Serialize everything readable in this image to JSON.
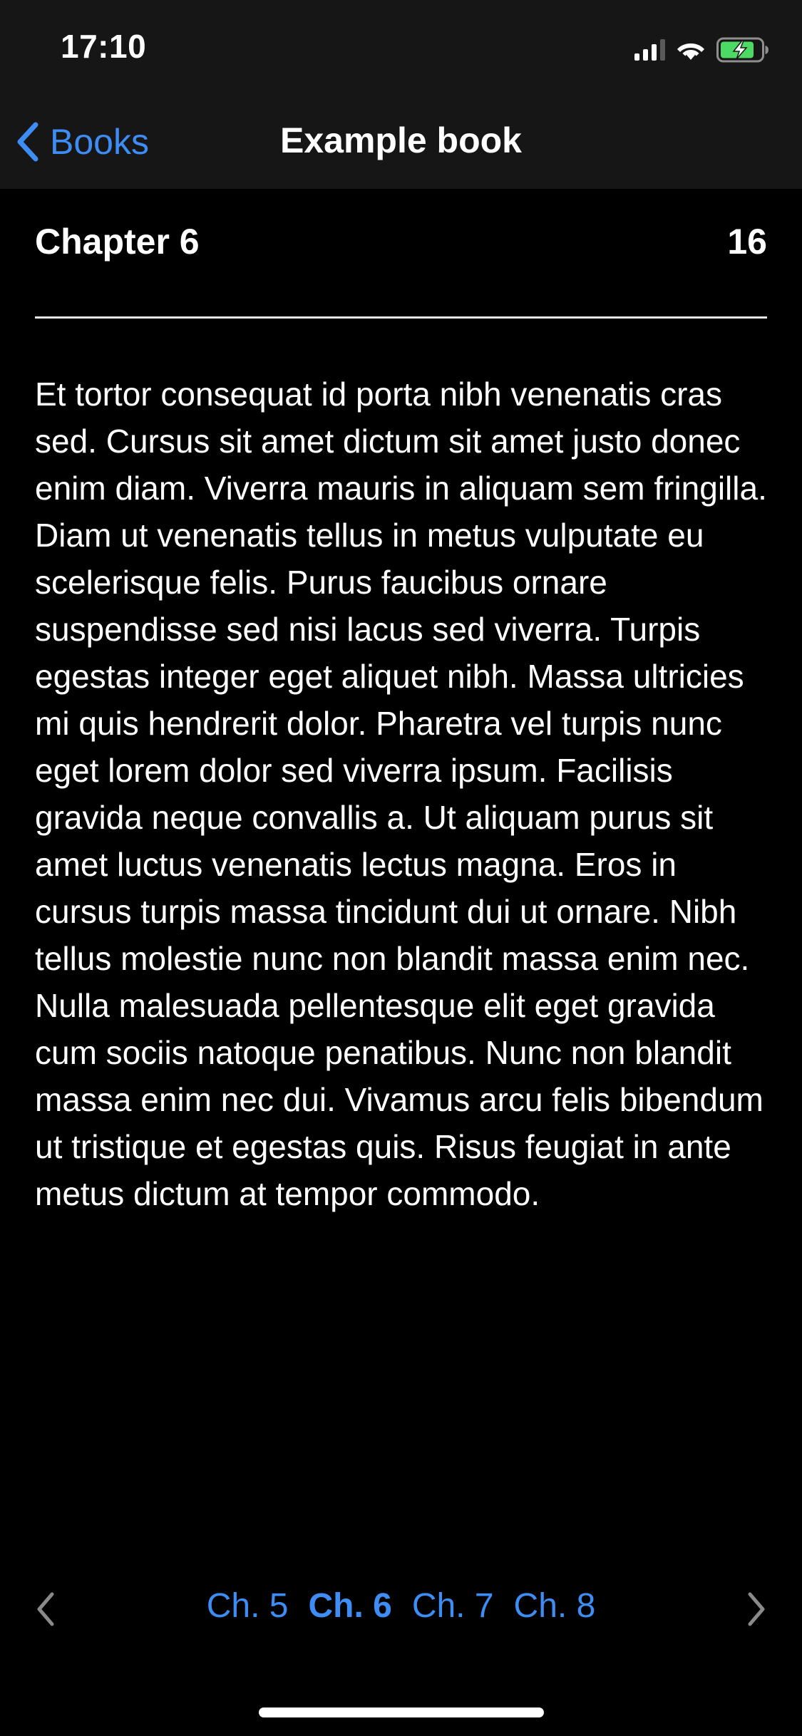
{
  "status_bar": {
    "time": "17:10",
    "icons": [
      "cellular-signal-icon",
      "wifi-icon",
      "battery-charging-icon"
    ]
  },
  "nav_bar": {
    "back_label": "Books",
    "title": "Example book"
  },
  "chapter": {
    "title": "Chapter 6",
    "page_number": "16",
    "body": "Et tortor consequat id porta nibh venenatis cras sed. Cursus sit amet dictum sit amet justo donec enim diam. Viverra mauris in aliquam sem fringilla. Diam ut venenatis tellus in metus vulputate eu scelerisque felis. Purus faucibus ornare suspendisse sed nisi lacus sed viverra. Turpis egestas integer eget aliquet nibh. Massa ultricies mi quis hendrerit dolor. Pharetra vel turpis nunc eget lorem dolor sed viverra ipsum. Facilisis gravida neque convallis a. Ut aliquam purus sit amet luctus venenatis lectus magna. Eros in cursus turpis massa tincidunt dui ut ornare. Nibh tellus molestie nunc non blandit massa enim nec. Nulla malesuada pellentesque elit eget gravida cum sociis natoque penatibus. Nunc non blandit massa enim nec dui. Vivamus arcu felis bibendum ut tristique et egestas quis. Risus feugiat in ante metus dictum at tempor commodo."
  },
  "chapter_nav": {
    "chapters": [
      "Ch. 5",
      "Ch. 6",
      "Ch. 7",
      "Ch. 8"
    ],
    "current_chapter": "Ch. 6"
  },
  "colors": {
    "accent": "#3d8df5",
    "background": "#000000",
    "nav_background": "#161616",
    "text": "#ffffff",
    "disabled_arrow": "#8a8a8a",
    "battery_charging": "#4cd964"
  }
}
